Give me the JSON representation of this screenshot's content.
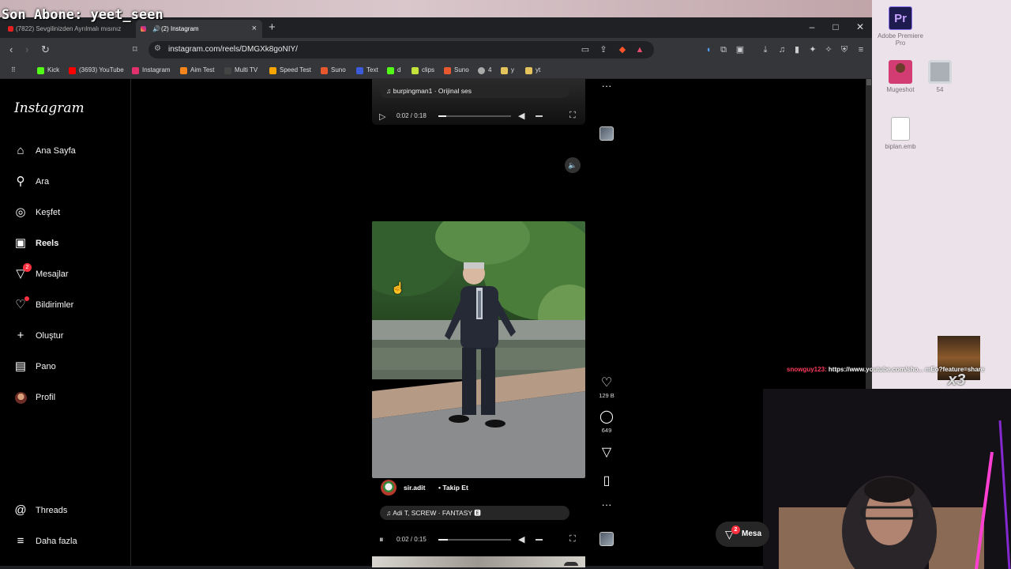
{
  "stream_overlay": {
    "text": "Son Abone: yeet_seen"
  },
  "browser": {
    "tabs": [
      {
        "label": "(7822) Sevgilinizden Ayrılmalı mısınız",
        "active": false
      },
      {
        "label": "(2) Instagram",
        "active": true
      }
    ],
    "new_tab": "+",
    "window_controls": [
      "–",
      "□",
      "✕"
    ],
    "url": "instagram.com/reels/DMGXk8goNIY/",
    "bookmarks": [
      {
        "label": "Kick",
        "color": "#53fc18"
      },
      {
        "label": "(3693) YouTube",
        "color": "#ff0000"
      },
      {
        "label": "Instagram",
        "color": "#e1306c"
      },
      {
        "label": "Aim Test",
        "color": "#f6851b"
      },
      {
        "label": "Multi TV",
        "color": "#444444"
      },
      {
        "label": "Speed Test",
        "color": "#f7a600"
      },
      {
        "label": "Suno",
        "color": "#e8582f"
      },
      {
        "label": "Text",
        "color": "#3b5bdb"
      },
      {
        "label": "d",
        "color": "#53fc18"
      },
      {
        "label": "clips",
        "color": "#c3e23a"
      },
      {
        "label": "Suno",
        "color": "#e8582f"
      },
      {
        "label": "4",
        "color": "#aaaaaa"
      },
      {
        "label": "y",
        "color": "#e5c35c"
      },
      {
        "label": "yt",
        "color": "#e5c35c"
      }
    ]
  },
  "instagram": {
    "logo": "Instagram",
    "nav": [
      {
        "label": "Ana Sayfa",
        "icon": "home-icon",
        "glyph": "⌂"
      },
      {
        "label": "Ara",
        "icon": "search-icon",
        "glyph": "⚲"
      },
      {
        "label": "Keşfet",
        "icon": "compass-icon",
        "glyph": "◎"
      },
      {
        "label": "Reels",
        "icon": "reels-icon",
        "glyph": "▣"
      },
      {
        "label": "Mesajlar",
        "icon": "messages-icon",
        "glyph": "▽",
        "badge": "2"
      },
      {
        "label": "Bildirimler",
        "icon": "heart-icon",
        "glyph": "♡"
      },
      {
        "label": "Oluştur",
        "icon": "plus-icon",
        "glyph": "+"
      },
      {
        "label": "Pano",
        "icon": "dashboard-icon",
        "glyph": "▤"
      },
      {
        "label": "Profil",
        "icon": "avatar",
        "glyph": ""
      }
    ],
    "nav_bottom": [
      {
        "label": "Threads",
        "icon": "threads-icon",
        "glyph": "@"
      },
      {
        "label": "Daha fazla",
        "icon": "menu-icon",
        "glyph": "≡"
      }
    ],
    "reel_prev": {
      "audio": "♫ burpingman1 · Orijinal ses",
      "time": "0:02 / 0:18",
      "progress": 0.11
    },
    "reel_current": {
      "likes": "129 B",
      "comments": "649",
      "author": "sir.adit",
      "follow": "Takip Et",
      "audio": "♫ Adi T, SCREW · FANTASY 🅴",
      "time": "0:02 / 0:15",
      "progress": 0.13
    },
    "messages_float": {
      "label": "Mesa",
      "badge": "2"
    }
  },
  "desktop": {
    "icons": [
      {
        "label": "Adobe Premiere Pro",
        "icon": "premiere-icon"
      },
      {
        "label": "Mugeshot",
        "icon": "person-icon"
      },
      {
        "label": "54",
        "icon": "watch-icon"
      },
      {
        "label": "biplan.emb",
        "icon": "file-icon"
      }
    ]
  },
  "stream_chat": {
    "user": "snowguy123:",
    "message": " https://www.youtube.com/sho... mEo?feature=share",
    "multiplier": "x3"
  }
}
